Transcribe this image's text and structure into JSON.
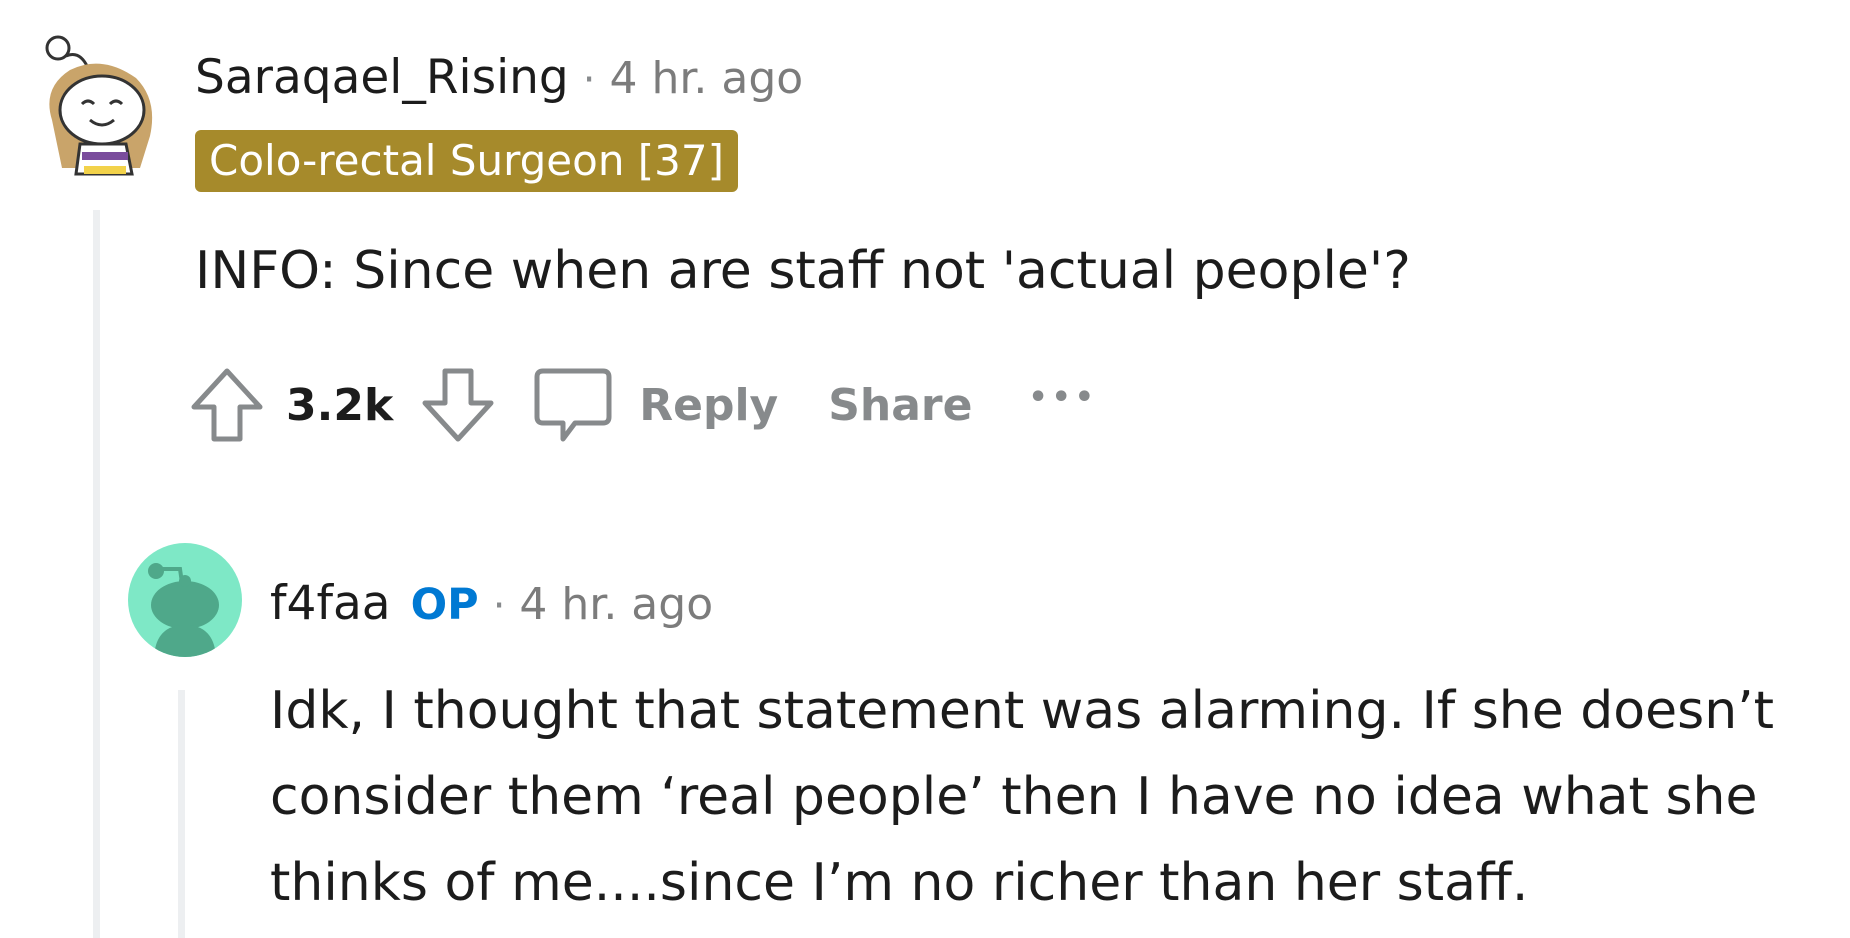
{
  "comments": [
    {
      "username": "Saraqael_Rising",
      "separator": "·",
      "timestamp": "4 hr. ago",
      "flair": "Colo-rectal Surgeon [37]",
      "body": "INFO: Since when are staff not 'actual people'?",
      "votes": "3.2k",
      "actions": {
        "reply": "Reply",
        "share": "Share",
        "more": "•••"
      },
      "avatar_icon": "snoo-avatar-icon"
    },
    {
      "username": "f4faa",
      "op_badge": "OP",
      "separator": "·",
      "timestamp": "4 hr. ago",
      "body": "Idk, I thought that statement was alarming. If she doesn’t consider them ‘real people’ then I have no idea what she thinks of me....since I’m no richer than her staff.",
      "avatar_icon": "default-snoo-avatar-icon"
    }
  ],
  "colors": {
    "flair_bg": "#a68a2b",
    "op_badge": "#0079d3",
    "meta_gray": "#878a8c",
    "avatar_mint": "#7ee8c6",
    "avatar_snoo": "#4fa88a",
    "thread_line": "#edeff1"
  }
}
